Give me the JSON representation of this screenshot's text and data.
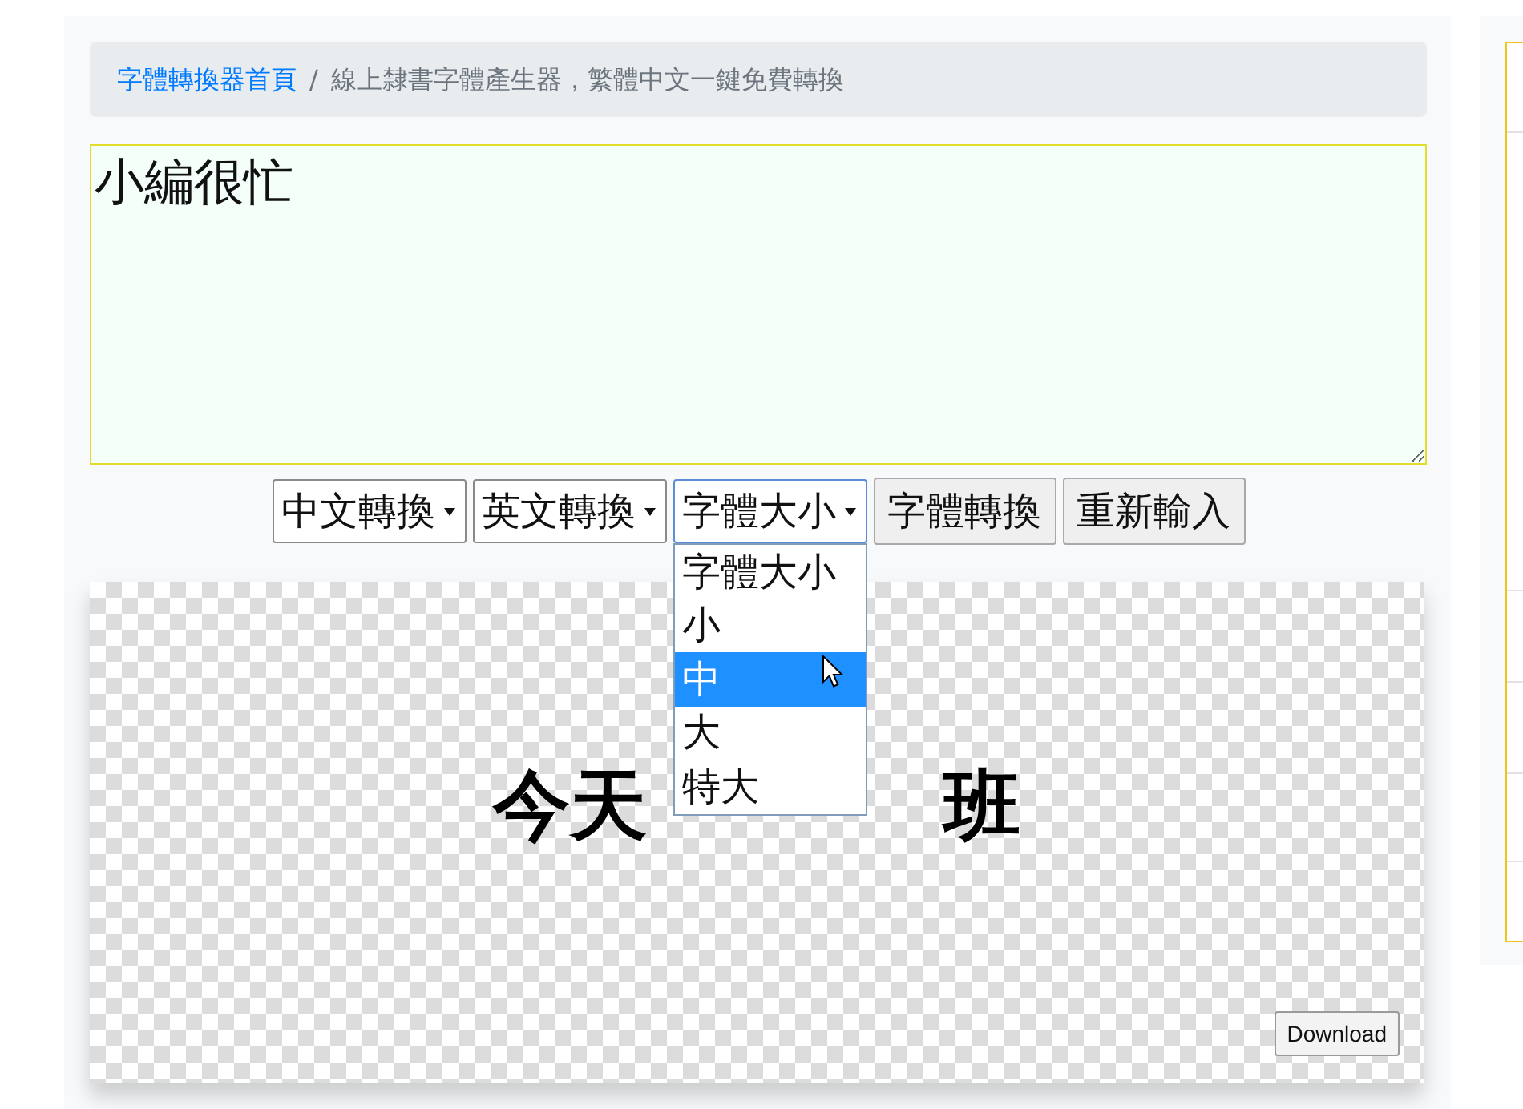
{
  "breadcrumb": {
    "separator": "/",
    "items": [
      {
        "kind": "link",
        "label": "字體轉換器首頁"
      },
      {
        "kind": "current",
        "label": "線上隸書字體產生器，繁體中文一鍵免費轉換"
      }
    ]
  },
  "text_input": {
    "value": "小編很忙"
  },
  "controls": [
    {
      "kind": "select",
      "label": "中文轉換",
      "expanded": false
    },
    {
      "kind": "select",
      "label": "英文轉換",
      "expanded": false
    },
    {
      "kind": "select",
      "label": "字體大小",
      "expanded": true,
      "options": [
        {
          "label": "字體大小",
          "selected": false
        },
        {
          "label": "小",
          "selected": false
        },
        {
          "label": "中",
          "selected": true
        },
        {
          "label": "大",
          "selected": false
        },
        {
          "label": "特大",
          "selected": false
        }
      ]
    },
    {
      "kind": "button",
      "label": "字體轉換"
    },
    {
      "kind": "button",
      "label": "重新輸入"
    }
  ],
  "preview": {
    "visible_text": [
      "今天",
      "班"
    ],
    "download_button": "Download"
  }
}
